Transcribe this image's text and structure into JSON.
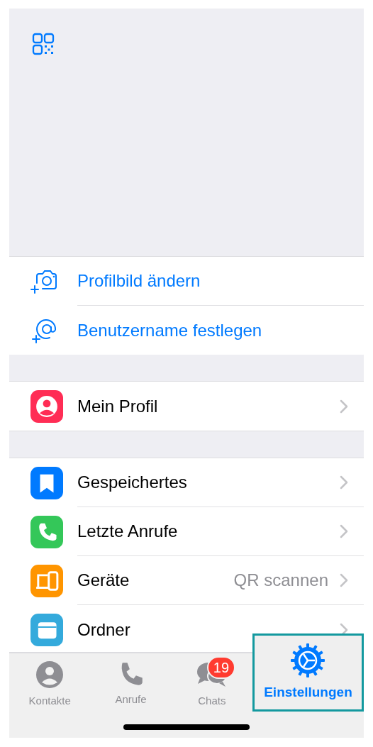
{
  "profile_actions": [
    {
      "kind": "camera",
      "label": "Profilbild ändern"
    },
    {
      "kind": "at",
      "label": "Benutzername festlegen"
    }
  ],
  "sections": [
    [
      {
        "kind": "profile",
        "label": "Mein Profil",
        "color": "#ff2d55"
      }
    ],
    [
      {
        "kind": "bookmark",
        "label": "Gespeichertes",
        "color": "#007aff"
      },
      {
        "kind": "phone",
        "label": "Letzte Anrufe",
        "color": "#34c759"
      },
      {
        "kind": "devices",
        "label": "Geräte",
        "value": "QR scannen",
        "color": "#ff9500"
      },
      {
        "kind": "folder",
        "label": "Ordner",
        "color": "#34aadc"
      }
    ]
  ],
  "tab_bar": [
    {
      "kind": "contacts",
      "label": "Kontakte",
      "selected": false
    },
    {
      "kind": "calls",
      "label": "Anrufe",
      "selected": false
    },
    {
      "kind": "chats",
      "label": "Chats",
      "badge": "19",
      "selected": false
    },
    {
      "kind": "settings",
      "label": "Einstellungen",
      "selected": true
    }
  ]
}
